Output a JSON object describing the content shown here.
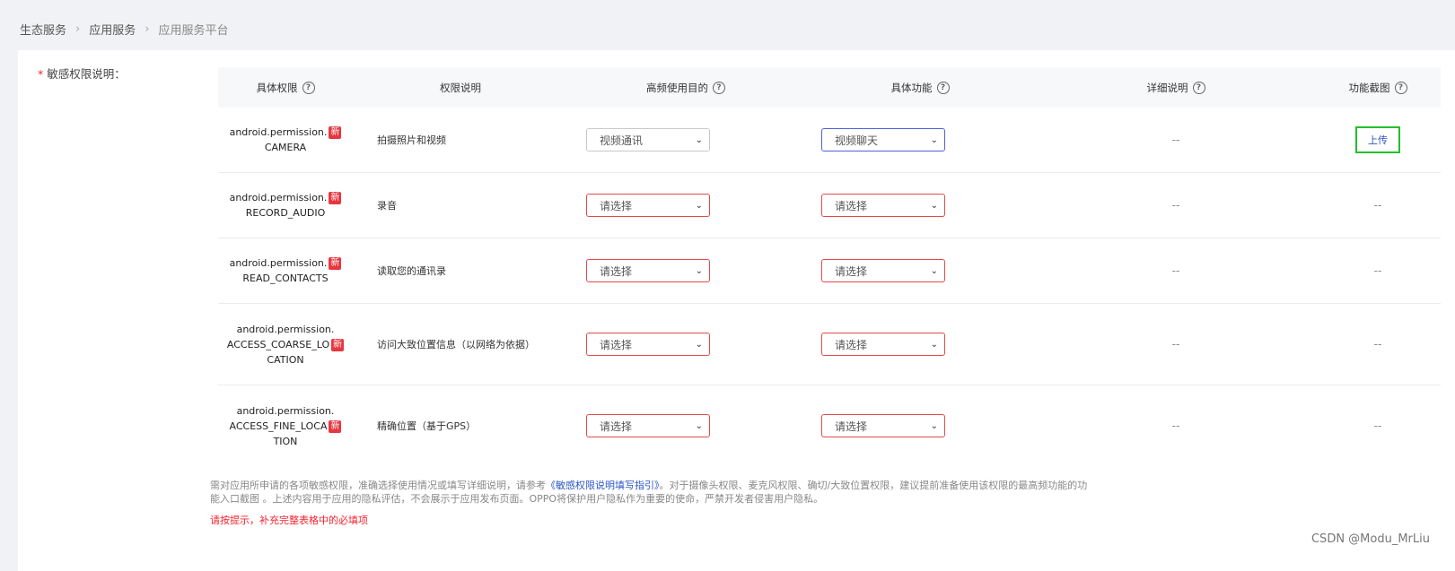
{
  "breadcrumb": {
    "items": [
      "生态服务",
      "应用服务",
      "应用服务平台"
    ],
    "separator": ">"
  },
  "form": {
    "required_mark": "*",
    "label": "敏感权限说明："
  },
  "table": {
    "headers": {
      "permission": "具体权限",
      "description": "权限说明",
      "purpose": "高频使用目的",
      "feature": "具体功能",
      "detail": "详细说明",
      "screenshot": "功能截图"
    },
    "help_glyph": "?",
    "new_badge": "新",
    "rows": [
      {
        "perm_line1": "android.permission.",
        "perm_line2": "CAMERA",
        "perm_line3": "",
        "description": "拍摄照片和视频",
        "purpose": "视频通讯",
        "feature": "视频聊天",
        "detail": "--",
        "screenshot": "上传"
      },
      {
        "perm_line1": "android.permission.",
        "perm_line2": "RECORD_AUDIO",
        "perm_line3": "",
        "description": "录音",
        "purpose": "请选择",
        "feature": "请选择",
        "detail": "--",
        "screenshot": "--"
      },
      {
        "perm_line1": "android.permission.",
        "perm_line2": "READ_CONTACTS",
        "perm_line3": "",
        "description": "读取您的通讯录",
        "purpose": "请选择",
        "feature": "请选择",
        "detail": "--",
        "screenshot": "--"
      },
      {
        "perm_line1": "android.permission.",
        "perm_line2": "ACCESS_COARSE_LO",
        "perm_line3": "CATION",
        "description": "访问大致位置信息（以网络为依据）",
        "purpose": "请选择",
        "feature": "请选择",
        "detail": "--",
        "screenshot": "--"
      },
      {
        "perm_line1": "android.permission.",
        "perm_line2": "ACCESS_FINE_LOCA",
        "perm_line3": "TION",
        "description": "精确位置（基于GPS）",
        "purpose": "请选择",
        "feature": "请选择",
        "detail": "--",
        "screenshot": "--"
      }
    ]
  },
  "hint": {
    "part1": "需对应用所申请的各项敏感权限，准确选择使用情况或填写详细说明，请参考",
    "link": "《敏感权限说明填写指引》",
    "part2": "。对于摄像头权限、麦克风权限、确切/大致位置权限，建议提前准备使用该权限的最高频功能的功能入口截图 。上述内容用于应用的隐私评估，不会展示于应用发布页面。OPPO将保护用户隐私作为重要的使命，严禁开发者侵害用户隐私。"
  },
  "error_text": "请按提示，补充完整表格中的必填项",
  "watermark": "CSDN @Modu_MrLiu"
}
